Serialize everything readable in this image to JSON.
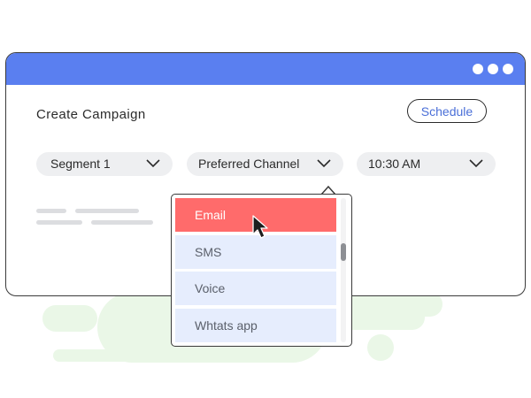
{
  "window": {
    "title": "Create Campaign",
    "schedule_button": "Schedule"
  },
  "filters": {
    "segment": "Segment 1",
    "channel": "Preferred Channel",
    "time": "10:30 AM"
  },
  "channel_dropdown": {
    "options": [
      "Email",
      "SMS",
      "Voice",
      "Whtats app"
    ],
    "highlighted": "Email"
  },
  "icons": {
    "window_controls": "dots-icon",
    "chevron": "chevron-down-icon",
    "pointer": "mouse-pointer-icon"
  },
  "colors": {
    "titlebar": "#5a7ff0",
    "accent_text": "#4a6fd8",
    "highlight": "#ff6b6b",
    "option_bg": "#e6edfd",
    "decor": "#eaf7e7"
  }
}
